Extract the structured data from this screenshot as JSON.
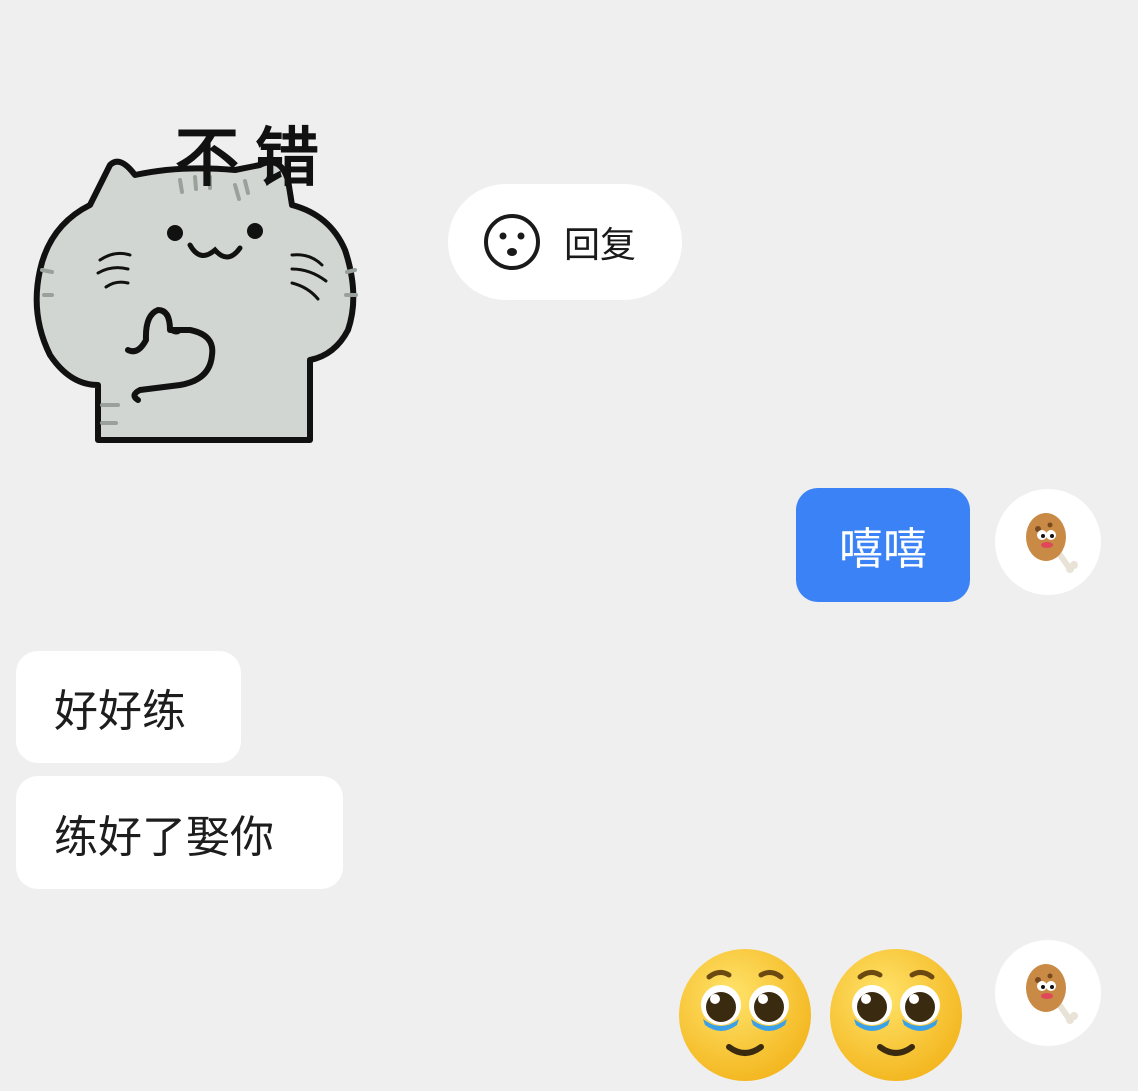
{
  "sticker": {
    "caption": "不错"
  },
  "reply": {
    "label": "回复",
    "icon": "smiley-icon"
  },
  "messages": [
    {
      "side": "right",
      "text": "嘻嘻"
    },
    {
      "side": "left",
      "text": "好好练"
    },
    {
      "side": "left",
      "text": "练好了娶你"
    },
    {
      "side": "right",
      "emojis": [
        "pleading-face",
        "pleading-face"
      ]
    }
  ],
  "avatar": {
    "icon": "chicken-drumstick-icon"
  },
  "colors": {
    "background": "#efefef",
    "outgoing_bubble": "#3b82f6",
    "incoming_bubble": "#ffffff"
  }
}
